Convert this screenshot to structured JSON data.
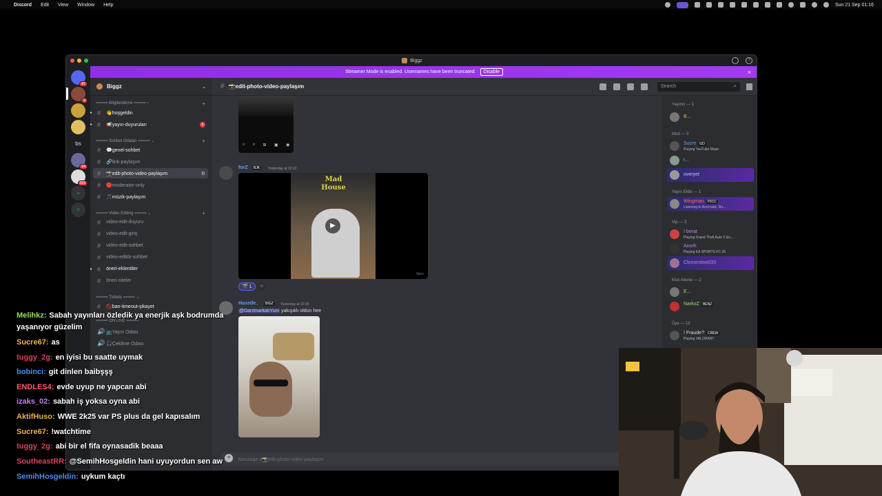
{
  "menubar": {
    "apple": "",
    "app": "Discord",
    "menus": [
      "Edit",
      "View",
      "Window",
      "Help"
    ],
    "clock": "Sun 21 Sep 01:16"
  },
  "window": {
    "title": "Biggz"
  },
  "banner": {
    "text": "Streamer Mode is enabled. Usernames have been truncated.",
    "disable": "Disable",
    "close": "×"
  },
  "rail": {
    "servers": [
      {
        "label": "",
        "badge": "87"
      },
      {
        "label": "",
        "badge": "6"
      },
      {
        "label": "",
        "badge": ""
      },
      {
        "label": "",
        "badge": ""
      },
      {
        "label": "bs",
        "badge": ""
      },
      {
        "label": "",
        "badge": "54"
      },
      {
        "label": "",
        "badge": "393"
      },
      {
        "label": "+",
        "badge": ""
      },
      {
        "label": "⌾",
        "badge": ""
      }
    ]
  },
  "sidebar": {
    "guild": "Biggz",
    "categories": [
      {
        "label": "===== Bilgilendirme ===== ›"
      },
      {
        "label": "===== Sohbet Odaları ===== ⌄"
      },
      {
        "label": "===== Video Editing ===== ⌄"
      },
      {
        "label": "===== Tickets ===== ⌄"
      },
      {
        "label": "===== ON LIVE ====="
      }
    ],
    "channels": [
      {
        "label": "👋hoşgeldin"
      },
      {
        "label": "📢yayın-duyuruları",
        "badge": "6"
      },
      {
        "label": "💬genel-sohbet"
      },
      {
        "label": "🔗link-paylaşım"
      },
      {
        "label": "📸edit-photo-video-paylaşım"
      },
      {
        "label": "🔴moderator-only"
      },
      {
        "label": "🎵müzik-paylaşım"
      },
      {
        "label": "video-edit-duyuru"
      },
      {
        "label": "video-edit-giriş"
      },
      {
        "label": "video-edit-sohbet"
      },
      {
        "label": "video-editör-sohbet"
      },
      {
        "label": "öneri-eklentiler"
      },
      {
        "label": "öneri-siteler"
      },
      {
        "label": "🚫ban-timeout-şikayet"
      },
      {
        "label": "📺Yayın Odası"
      },
      {
        "label": "🎧Çekilme Odası"
      }
    ]
  },
  "chat": {
    "channel": "📸edit-photo-video-paylaşım",
    "search_placeholder": "Search",
    "composer_placeholder": "Message #📸edit-photo-video-paylaşım",
    "messages": [
      {
        "author": "forZ",
        "tag": "BJK",
        "time": "Yesterday at 22:22",
        "reaction_count": "1",
        "video_caption": "Mad House",
        "video_source": "Vaco"
      },
      {
        "author": "Husstle_",
        "tag": "BIGZ",
        "time": "Yesterday at 22:26",
        "mention": "@DanimarkalıYuni",
        "text": "yakışıklı oldun hee"
      }
    ]
  },
  "members": {
    "groups": [
      {
        "label": "Yayıncı — 1"
      },
      {
        "label": "Mod — 3"
      },
      {
        "label": "Yayın Ekibi — 1"
      },
      {
        "label": "Vip — 3"
      },
      {
        "label": "Kick Abone — 2"
      },
      {
        "label": "Üye — 12"
      }
    ],
    "list": [
      {
        "name": "B...",
        "activity": "",
        "tag": ""
      },
      {
        "name": "Sucre",
        "activity": "Playing YouTube Music",
        "tag": "GD"
      },
      {
        "name": "t...",
        "activity": "",
        "tag": ""
      },
      {
        "name": "overyet",
        "activity": "",
        "tag": ""
      },
      {
        "name": "Wingman",
        "activity": "Listening to Bırocratic, Ro...",
        "tag": "P3CC"
      },
      {
        "name": "! berat",
        "activity": "Playing Grand Theft Auto V En...",
        "tag": ""
      },
      {
        "name": "Anorh",
        "activity": "Playing EA SPORTS FC 26",
        "tag": ""
      },
      {
        "name": "Clementine033",
        "activity": "",
        "tag": ""
      },
      {
        "name": "E...",
        "activity": "",
        "tag": ""
      },
      {
        "name": "NarkoZ",
        "activity": "",
        "tag": "BENZ"
      },
      {
        "name": "! Fraude?",
        "activity": "Playing VALORANT",
        "tag": "CREW"
      }
    ]
  },
  "overlay_chat": [
    {
      "name": "Melihkz:",
      "text": "Sabah yayınları özledik ya enerjik aşk bodrumda",
      "color": "#9be05f"
    },
    {
      "name": "",
      "text": "yaşanıyor güzelim",
      "color": "#ffffff"
    },
    {
      "name": "Sucre67:",
      "text": "as",
      "color": "#f2b34a"
    },
    {
      "name": "tuggy_2g:",
      "text": "en iyisi bu saatte uymak",
      "color": "#e0405a"
    },
    {
      "name": "bobinci:",
      "text": "git dinlen baibşşş",
      "color": "#4a8ef0"
    },
    {
      "name": "ENDLES4:",
      "text": "evde uyup ne yapcan abi",
      "color": "#ff5a6e"
    },
    {
      "name": "izaks_02:",
      "text": "sabah iş yoksa oyna abi",
      "color": "#c77dff"
    },
    {
      "name": "AktifHuso:",
      "text": "WWE 2k25 var PS plus da gel kapısalım",
      "color": "#f0b040"
    },
    {
      "name": "Sucre67:",
      "text": "!watchtime",
      "color": "#f2b34a"
    },
    {
      "name": "tuggy_2g:",
      "text": "abi bir el fifa oynasadik beaaa",
      "color": "#e0405a"
    },
    {
      "name": "SoutheastRR:",
      "text": "@SemihHosgeldin hani uyuyordun sen aw",
      "color": "#e0405a"
    },
    {
      "name": "SemihHosgeldin:",
      "text": "uykum kaçtı",
      "color": "#4a8ef0"
    }
  ]
}
